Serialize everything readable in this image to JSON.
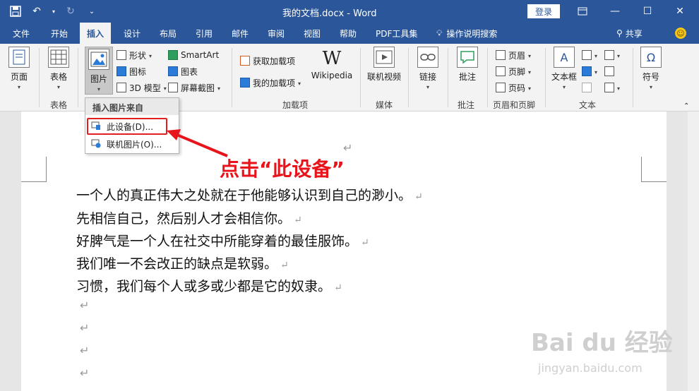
{
  "window": {
    "title": "我的文档.docx - Word",
    "login_label": "登录"
  },
  "tabs": [
    {
      "label": "文件"
    },
    {
      "label": "开始"
    },
    {
      "label": "插入"
    },
    {
      "label": "设计"
    },
    {
      "label": "布局"
    },
    {
      "label": "引用"
    },
    {
      "label": "邮件"
    },
    {
      "label": "审阅"
    },
    {
      "label": "视图"
    },
    {
      "label": "帮助"
    },
    {
      "label": "PDF工具集"
    }
  ],
  "tell_me": "操作说明搜索",
  "share": "共享",
  "ribbon": {
    "pages": {
      "label": "页面"
    },
    "table": {
      "label": "表格",
      "group": "表格"
    },
    "pictures": {
      "label": "图片"
    },
    "shapes": "形状",
    "icons": "图标",
    "model3d": "3D 模型",
    "smartart": "SmartArt",
    "chart": "图表",
    "screenshot": "屏幕截图",
    "get_addins": "获取加载项",
    "my_addins": "我的加载项",
    "wikipedia": "Wikipedia",
    "addins_group": "加载项",
    "online_video": "联机视频",
    "media_group": "媒体",
    "link": "链接",
    "comment": "批注",
    "comment_group": "批注",
    "header": "页眉",
    "footer": "页脚",
    "page_number": "页码",
    "header_footer_group": "页眉和页脚",
    "textbox": "文本框",
    "text_group": "文本",
    "symbol": "符号"
  },
  "dropdown": {
    "header": "插入图片来自",
    "this_device": "此设备(D)...",
    "online_pictures": "联机图片(O)..."
  },
  "annotation": "点击“此设备”",
  "document": {
    "paragraphs": [
      "一个人的真正伟大之处就在于他能够认识到自己的渺小。",
      "先相信自己，然后别人才会相信你。",
      "好脾气是一个人在社交中所能穿着的最佳服饰。",
      "我们唯一不会改正的缺点是软弱。",
      "习惯，我们每个人或多或少都是它的奴隶。"
    ],
    "para_mark": "↵"
  },
  "watermark": {
    "brand": "Bai du 经验",
    "url": "jingyan.baidu.com"
  },
  "colors": {
    "accent": "#2b579a",
    "annotation": "#e8141b"
  }
}
